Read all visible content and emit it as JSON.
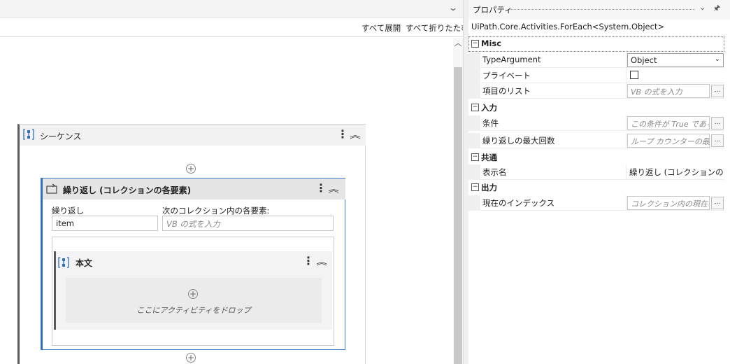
{
  "designer": {
    "expand_all": "すべて展開",
    "collapse_all": "すべて折りたたむ",
    "sequence": {
      "title": "シーケンス"
    },
    "foreach": {
      "title": "繰り返し (コレクションの各要素)",
      "item_label": "繰り返し",
      "item_value": "item",
      "collection_label": "次のコレクション内の各要素:",
      "collection_placeholder": "VB の式を入力"
    },
    "body": {
      "title": "本文",
      "drop_text": "ここにアクティビティをドロップ"
    }
  },
  "properties": {
    "panel_title": "プロパティ",
    "type_name": "UiPath.Core.Activities.ForEach<System.Object>",
    "categories": {
      "misc": "Misc",
      "input": "入力",
      "common": "共通",
      "output": "出力"
    },
    "rows": {
      "type_argument": {
        "label": "TypeArgument",
        "value": "Object"
      },
      "private": {
        "label": "プライベート",
        "checked": false
      },
      "values": {
        "label": "項目のリスト",
        "placeholder": "VB の式を入力"
      },
      "condition": {
        "label": "条件",
        "placeholder": "この条件が True である"
      },
      "max_iterations": {
        "label": "繰り返しの最大回数",
        "placeholder": "ループ カウンターの最大"
      },
      "display_name": {
        "label": "表示名",
        "value": "繰り返し (コレクションの各要素)"
      },
      "current_index": {
        "label": "現在のインデックス",
        "placeholder": "コレクション内の現在の"
      }
    },
    "ellipsis": "..."
  },
  "colors": {
    "accent": "#2f6fc4",
    "selection_border": "#3c7ac8"
  }
}
